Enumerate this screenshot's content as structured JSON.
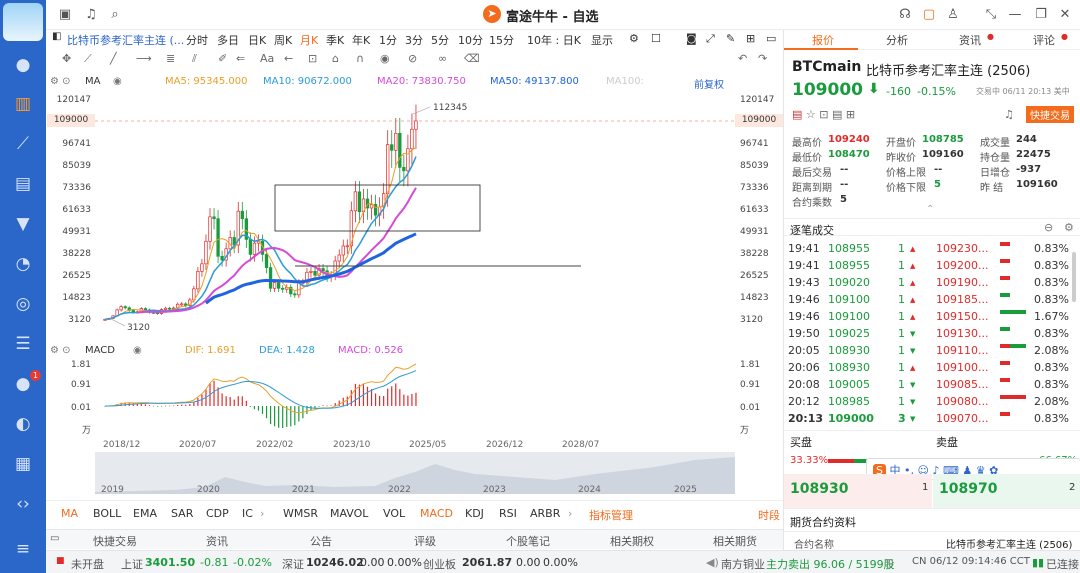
{
  "app": {
    "title": "富途牛牛 - 自选"
  },
  "sidebar": {
    "badge": "1"
  },
  "toolbar": {
    "symbol": "比特币参考汇率主连 (...",
    "timeframes": [
      "分时",
      "多日",
      "日K",
      "周K",
      "月K",
      "季K",
      "年K",
      "1分",
      "3分",
      "5分",
      "10分",
      "15分",
      "10年 : 日K"
    ],
    "active_timeframe": "月K",
    "display": "显示"
  },
  "ma": {
    "label": "MA",
    "ma5": "MA5: 95345.000",
    "ma10": "MA10: 90672.000",
    "ma20": "MA20: 73830.750",
    "ma50": "MA50: 49137.800",
    "ma100": "MA100:",
    "adjust": "前复权"
  },
  "chart": {
    "y_left": [
      "120147",
      "109000",
      "96741",
      "85039",
      "73336",
      "61633",
      "49931",
      "38228",
      "26525",
      "14823",
      "3120"
    ],
    "y_right": [
      "120147",
      "109000",
      "96741",
      "85039",
      "73336",
      "61633",
      "49931",
      "38228",
      "26525",
      "14823",
      "3120"
    ],
    "high_marker": "112345",
    "low_marker": "3120",
    "x_labels": [
      "2018/12",
      "2020/07",
      "2022/02",
      "2023/10",
      "2025/05",
      "2026/12",
      "2028/07"
    ],
    "mini_labels": [
      "2019",
      "2020",
      "2021",
      "2022",
      "2023",
      "2024",
      "2025"
    ]
  },
  "macd": {
    "label": "MACD",
    "dif": "DIF: 1.691",
    "dea": "DEA: 1.428",
    "macd": "MACD: 0.526",
    "y_labels": [
      "1.81",
      "0.91",
      "0.01",
      "万"
    ],
    "y_labels_r": [
      "1.81",
      "0.91",
      "0.01",
      "万"
    ]
  },
  "indicators": {
    "items": [
      "MA",
      "BOLL",
      "EMA",
      "SAR",
      "CDP",
      "IC",
      "WMSR",
      "MAVOL",
      "VOL",
      "MACD",
      "KDJ",
      "RSI",
      "ARBR"
    ],
    "active": [
      "MA",
      "MACD"
    ],
    "manage": "指标管理",
    "time": "时段"
  },
  "bottomnav": {
    "items": [
      "快捷交易",
      "资讯",
      "公告",
      "评级",
      "个股笔记",
      "相关期权",
      "相关期货"
    ]
  },
  "status": {
    "market_state": "未开盘",
    "sh_label": "上证",
    "sh_value": "3401.50",
    "sh_change": "-0.81",
    "sh_pct": "-0.02%",
    "sz_label": "深证",
    "sz_value": "10246.02",
    "sz_change": "0.00",
    "sz_pct": "0.00%",
    "cy_label": "创业板",
    "cy_value": "2061.87",
    "cy_change": "0.00",
    "cy_pct": "0.00%",
    "news_stock": "南方铜业",
    "news_text": "主力卖出 96.06 / 5199股",
    "clock": "CN 06/12 09:14:46 CCT",
    "conn": "已连接"
  },
  "right": {
    "tabs": [
      "报价",
      "分析",
      "资讯",
      "评论"
    ],
    "ticker": "BTCmain",
    "name": "比特币参考汇率主连 (2506)",
    "price": "109000",
    "change": "-160",
    "pct": "-0.15%",
    "session": "交易中 06/11 20:13 美中",
    "quick_trade": "快捷交易",
    "stats": [
      {
        "label": "最高价",
        "value": "109240",
        "color": "up"
      },
      {
        "label": "开盘价",
        "value": "108785",
        "color": "down"
      },
      {
        "label": "成交量",
        "value": "244",
        "color": "none"
      },
      {
        "label": "最低价",
        "value": "108470",
        "color": "down"
      },
      {
        "label": "昨收价",
        "value": "109160",
        "color": "none"
      },
      {
        "label": "持仓量",
        "value": "22475",
        "color": "none"
      },
      {
        "label": "最后交易",
        "value": "--",
        "color": "none"
      },
      {
        "label": "价格上限",
        "value": "--",
        "color": "none"
      },
      {
        "label": "日增仓",
        "value": "-937",
        "color": "none"
      },
      {
        "label": "距离到期",
        "value": "--",
        "color": "none"
      },
      {
        "label": "价格下限",
        "value": "5",
        "color": "down"
      },
      {
        "label": "昨 结",
        "value": "109160",
        "color": "none"
      },
      {
        "label": "合约乘数",
        "value": "5",
        "color": "none"
      }
    ],
    "trades_title": "逐笔成交",
    "trades": [
      {
        "time": "19:41",
        "price": "108955",
        "vol": "1",
        "dir": "up",
        "oi": "109230...",
        "bar": "short-r",
        "pct": "0.83%"
      },
      {
        "time": "19:41",
        "price": "108955",
        "vol": "1",
        "dir": "up",
        "oi": "109200...",
        "bar": "short-r",
        "pct": "0.83%"
      },
      {
        "time": "19:43",
        "price": "109020",
        "vol": "1",
        "dir": "up",
        "oi": "109190...",
        "bar": "short-r",
        "pct": "0.83%"
      },
      {
        "time": "19:46",
        "price": "109100",
        "vol": "1",
        "dir": "up",
        "oi": "109185...",
        "bar": "short-g",
        "pct": "0.83%"
      },
      {
        "time": "19:46",
        "price": "109100",
        "vol": "1",
        "dir": "up",
        "oi": "109150...",
        "bar": "long-g",
        "pct": "1.67%"
      },
      {
        "time": "19:50",
        "price": "109025",
        "vol": "1",
        "dir": "down",
        "oi": "109130...",
        "bar": "short-g",
        "pct": "0.83%"
      },
      {
        "time": "20:05",
        "price": "108930",
        "vol": "1",
        "dir": "down",
        "oi": "109110...",
        "bar": "mix",
        "pct": "2.08%"
      },
      {
        "time": "20:06",
        "price": "108930",
        "vol": "1",
        "dir": "up",
        "oi": "109100...",
        "bar": "short-r",
        "pct": "0.83%"
      },
      {
        "time": "20:08",
        "price": "109005",
        "vol": "1",
        "dir": "down",
        "oi": "109085...",
        "bar": "short-r",
        "pct": "0.83%"
      },
      {
        "time": "20:12",
        "price": "108985",
        "vol": "1",
        "dir": "down",
        "oi": "109080...",
        "bar": "long-r",
        "pct": "2.08%"
      },
      {
        "time": "20:13",
        "price": "109000",
        "vol": "3",
        "dir": "down",
        "oi": "109070...",
        "bar": "short-r",
        "pct": "0.83%"
      }
    ],
    "bid_title": "买盘",
    "ask_title": "卖盘",
    "bid_pct": "33.33%",
    "ask_pct": "66.67%",
    "bid_price": "108930",
    "bid_vol": "1",
    "ask_price": "108970",
    "ask_vol": "2",
    "contract_title": "期货合约资料",
    "contract_label": "合约名称",
    "contract_value": "比特币参考汇率主连 (2506)"
  }
}
